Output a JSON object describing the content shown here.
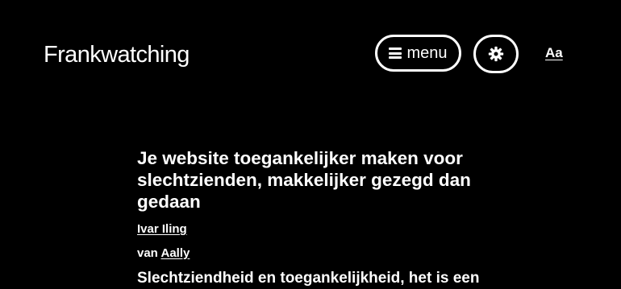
{
  "header": {
    "logo": "Frankwatching",
    "menu_label": "menu",
    "menu_icon": "hamburger-icon",
    "settings_icon": "gear-icon",
    "font_size_label": "Aa"
  },
  "article": {
    "title": "Je website toegankelijker maken voor slechtzienden, makkelijker gezegd dan gedaan",
    "author": "Ivar Iling",
    "org_prefix": "van",
    "org": "Aally",
    "intro": "Slechtziendheid en toegankelijkheid, het is een"
  },
  "colors": {
    "background": "#000000",
    "foreground": "#ffffff"
  }
}
